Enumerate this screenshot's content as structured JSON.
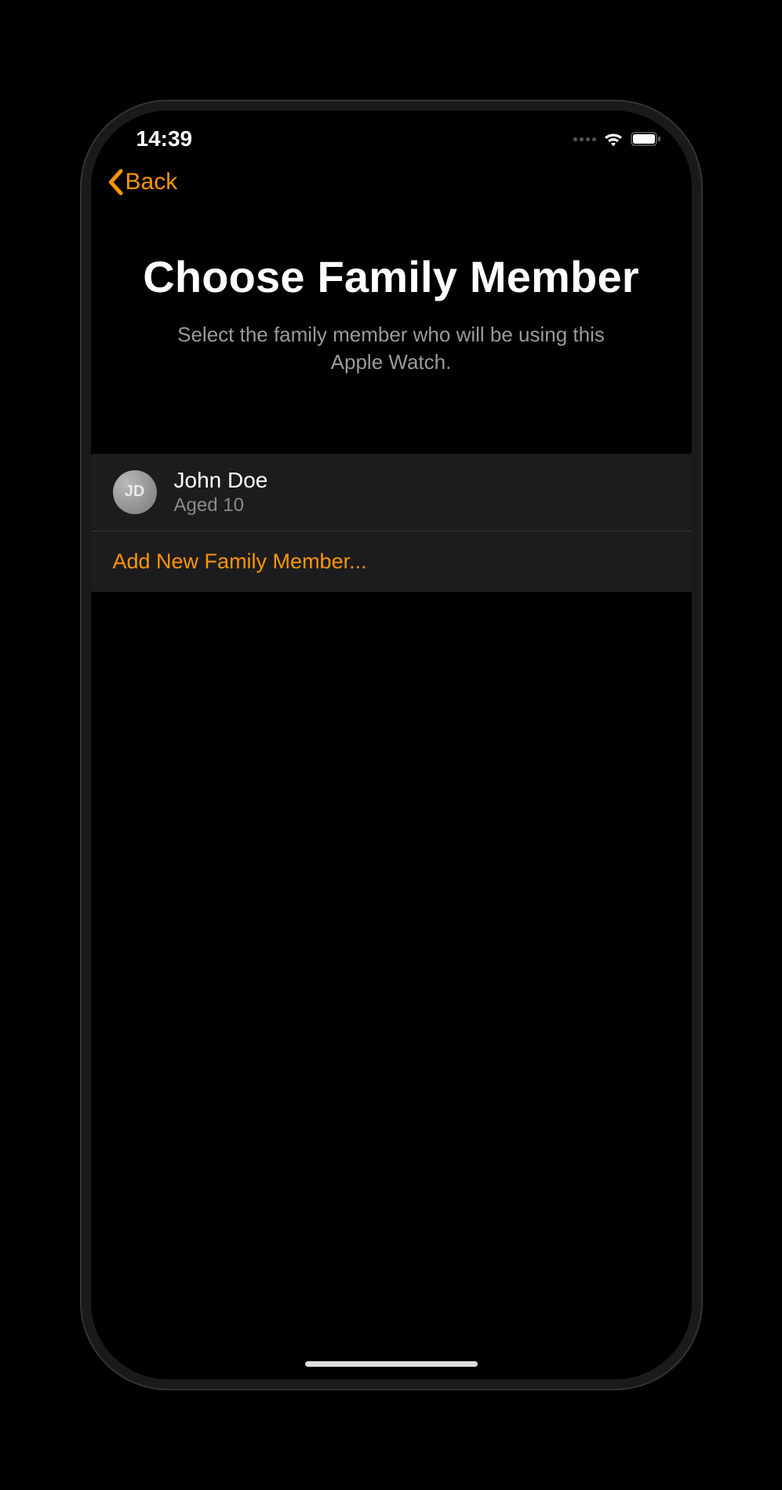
{
  "status_bar": {
    "time": "14:39"
  },
  "nav": {
    "back_label": "Back"
  },
  "header": {
    "title": "Choose Family Member",
    "subtitle": "Select the family member who will be using this Apple Watch."
  },
  "members": [
    {
      "initials": "JD",
      "name": "John Doe",
      "age_label": "Aged 10"
    }
  ],
  "add_member_label": "Add New Family Member...",
  "colors": {
    "accent": "#ff9500"
  }
}
